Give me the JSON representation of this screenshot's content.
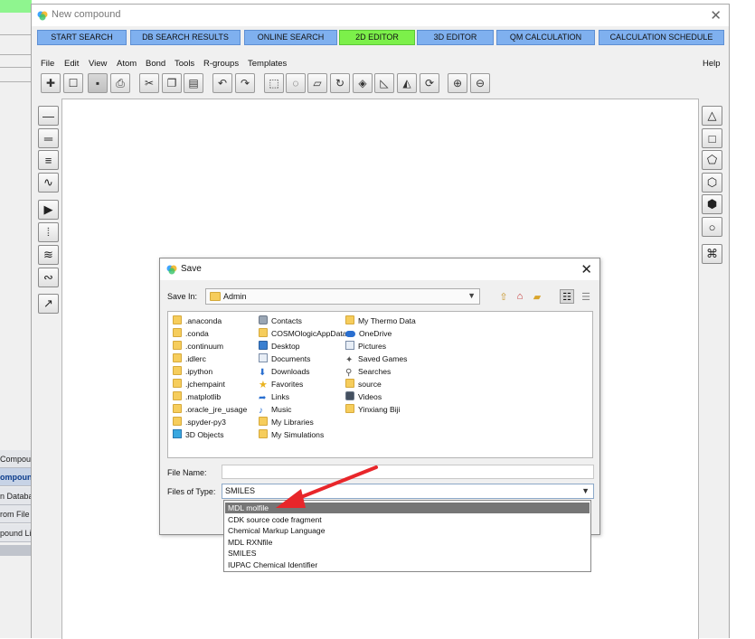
{
  "window": {
    "title": "New compound"
  },
  "tabs": [
    {
      "label": "START SEARCH",
      "active": false
    },
    {
      "label": "DB SEARCH RESULTS",
      "active": false
    },
    {
      "label": "ONLINE SEARCH",
      "active": false
    },
    {
      "label": "2D EDITOR",
      "active": true
    },
    {
      "label": "3D EDITOR",
      "active": false
    },
    {
      "label": "QM CALCULATION",
      "active": false
    },
    {
      "label": "CALCULATION SCHEDULE",
      "active": false
    }
  ],
  "menu": [
    "File",
    "Edit",
    "View",
    "Atom",
    "Bond",
    "Tools",
    "R-groups",
    "Templates"
  ],
  "help_label": "Help",
  "bg_sidebar": {
    "items": [
      {
        "label": "Compou",
        "active": false
      },
      {
        "label": "ompoun",
        "active": true
      },
      {
        "label": "n Databas",
        "active": false
      },
      {
        "label": "rom File",
        "active": false
      },
      {
        "label": "pound Lis",
        "active": false
      }
    ]
  },
  "dialog": {
    "title": "Save",
    "save_in_label": "Save In:",
    "save_in_value": "Admin",
    "file_name_label": "File Name:",
    "file_name_value": "",
    "files_of_type_label": "Files of Type:",
    "files_of_type_value": "SMILES",
    "files": [
      [
        ".anaconda",
        ".conda",
        ".continuum",
        ".idlerc",
        ".ipython",
        ".jchempaint",
        ".matplotlib",
        ".oracle_jre_usage",
        ".spyder-py3",
        "3D Objects"
      ],
      [
        "Contacts",
        "COSMOlogicAppData",
        "Desktop",
        "Documents",
        "Downloads",
        "Favorites",
        "Links",
        "Music",
        "My Libraries",
        "My Simulations"
      ],
      [
        "My Thermo Data",
        "OneDrive",
        "Pictures",
        "Saved Games",
        "Searches",
        "source",
        "Videos",
        "Yinxiang Biji"
      ]
    ],
    "file_types": [
      "MDL molfile",
      "CDK source code fragment",
      "Chemical Markup Language",
      "MDL RXNfile",
      "SMILES",
      "IUPAC Chemical Identifier"
    ],
    "selected_type_index": 0
  },
  "colors": {
    "tab": "#7fb0ef",
    "tab_active": "#7cf04a",
    "annotation_arrow": "#e8262a"
  }
}
